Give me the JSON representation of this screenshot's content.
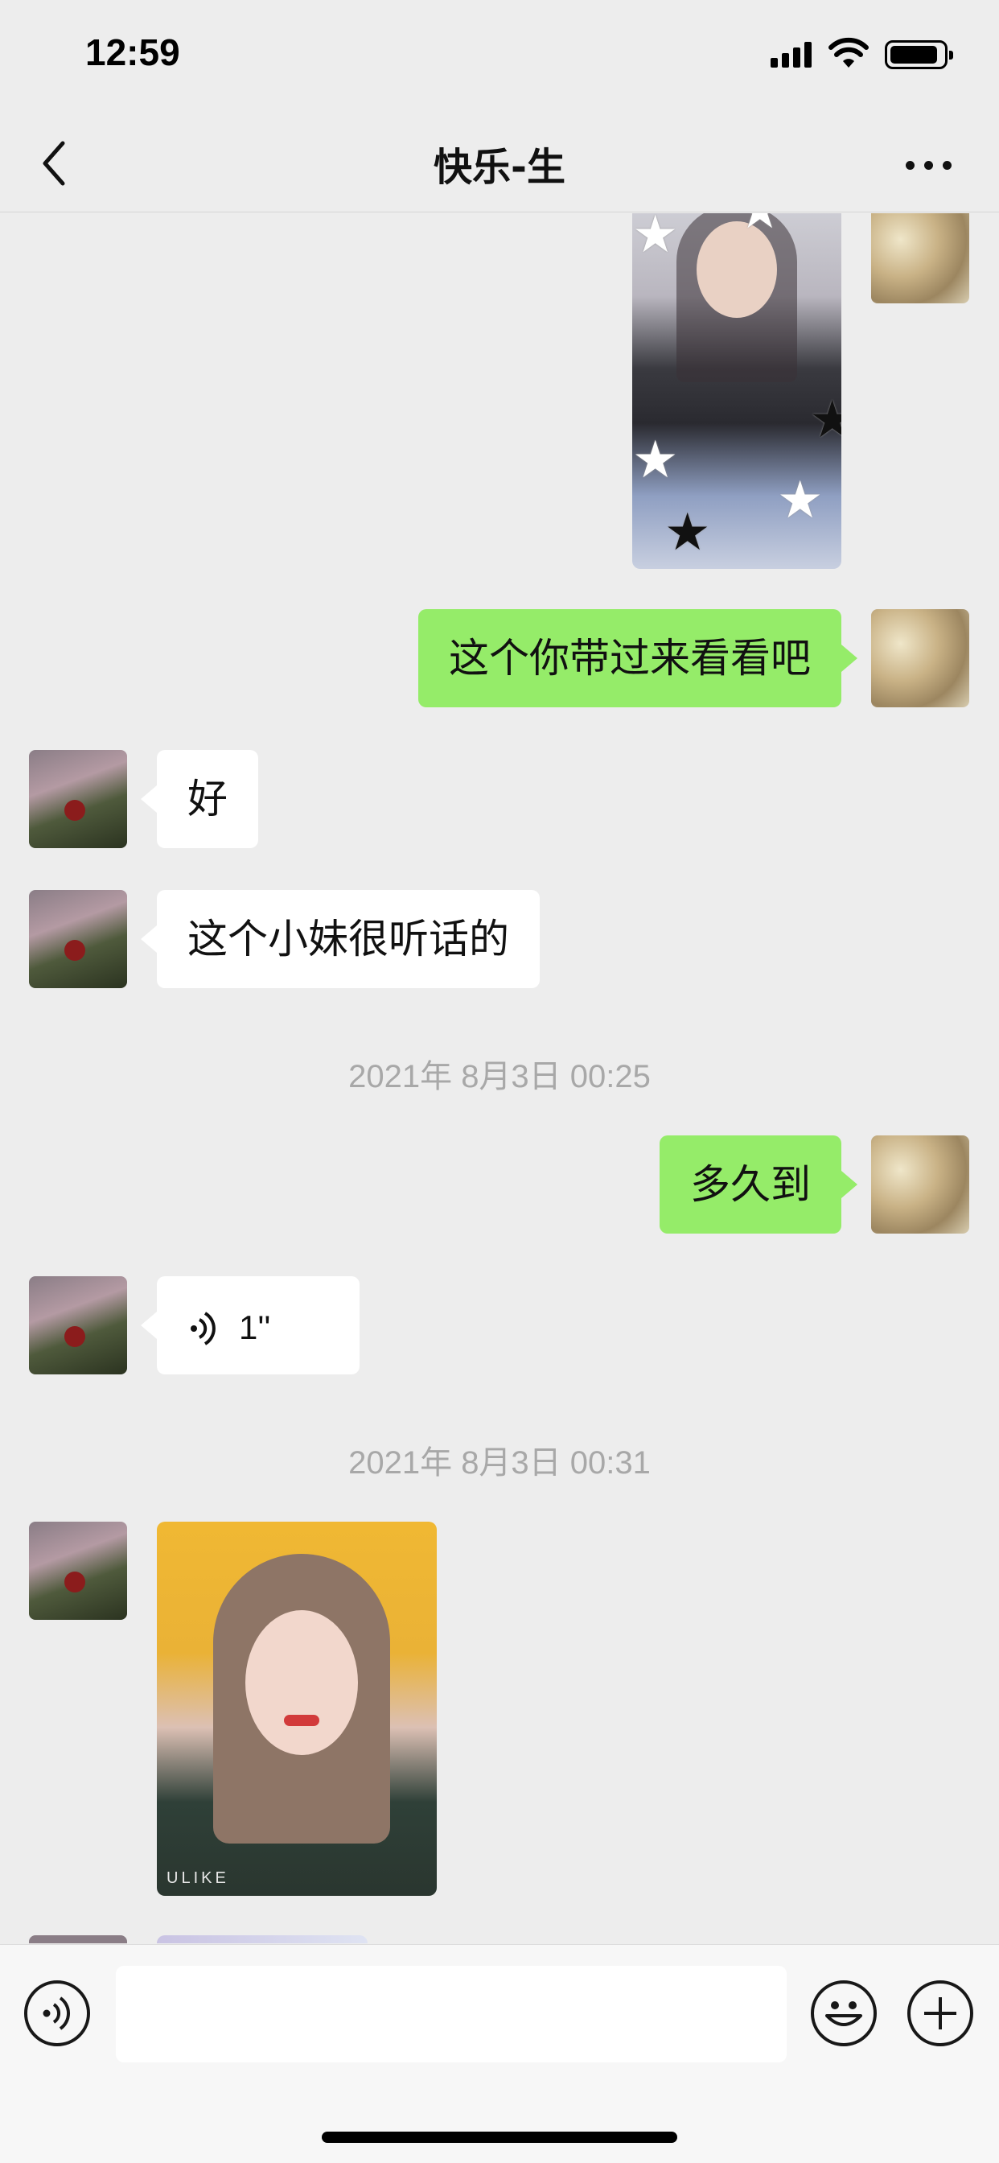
{
  "status_bar": {
    "time": "12:59"
  },
  "header": {
    "title": "快乐-生"
  },
  "messages": {
    "m1_text": "这个你带过来看看吧",
    "m2_text": "好",
    "m3_text": "这个小妹很听话的",
    "ts1": "2021年 8月3日 00:25",
    "m4_text": "多久到",
    "m5_voice_duration": "1''",
    "ts2": "2021年 8月3日 00:31",
    "photo2_watermark": "ULIKE"
  },
  "input": {
    "value": "",
    "placeholder": ""
  },
  "colors": {
    "background": "#ededed",
    "sent_bubble": "#95ec69",
    "received_bubble": "#ffffff"
  },
  "icons": {
    "back": "chevron-left-icon",
    "more": "more-dots-icon",
    "voice": "voice-icon",
    "emoji": "emoji-icon",
    "plus": "plus-icon"
  }
}
